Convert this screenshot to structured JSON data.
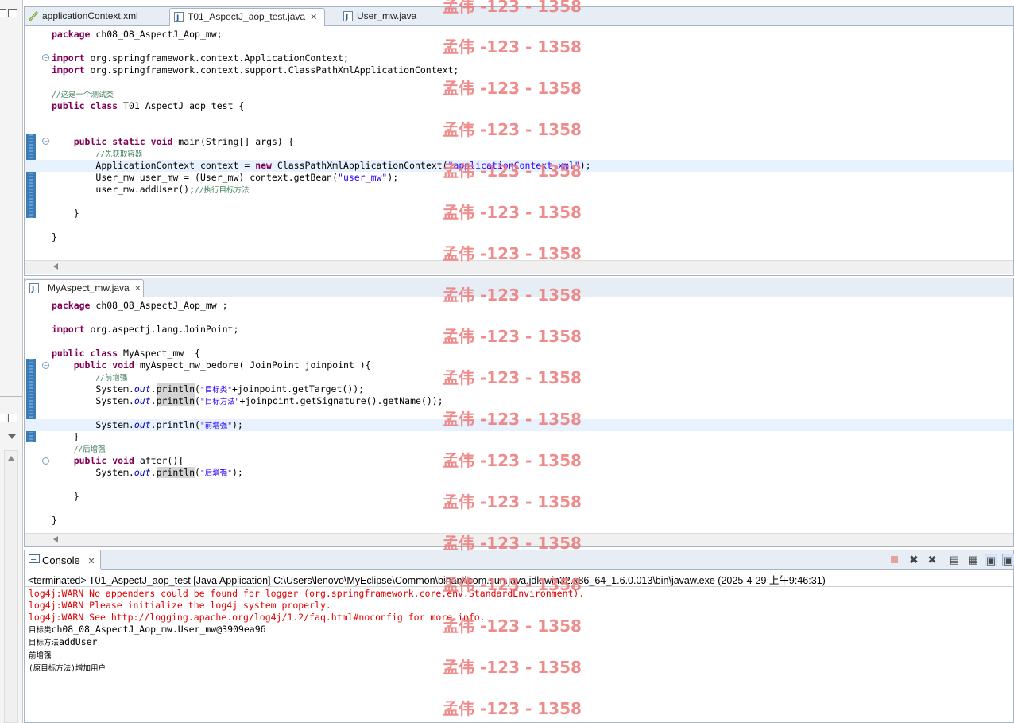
{
  "editor1": {
    "tabs": [
      {
        "label": "applicationContext.xml",
        "icon": "xml-file-icon"
      },
      {
        "label": "T01_AspectJ_aop_test.java",
        "icon": "java-file-icon",
        "active": true
      },
      {
        "label": "User_mw.java",
        "icon": "java-file-icon"
      }
    ],
    "close_glyph": "✕",
    "code": {
      "pkg_kw": "package",
      "pkg": " ch08_08_AspectJ_Aop_mw;",
      "imp_kw": "import",
      "imp1": " org.springframework.context.ApplicationContext;",
      "imp2": " org.springframework.context.support.ClassPathXmlApplicationContext;",
      "cm_class": "//这是一个测试类",
      "pub": "public",
      "cls": "class",
      "cls_decl": " T01_AspectJ_aop_test {",
      "stat": "static",
      "void": "void",
      "main_decl": " main(String[] args) {",
      "cm_get": "//先获取容器",
      "ctx_a": "ApplicationContext context = ",
      "new": "new",
      "ctx_b": " ClassPathXmlApplicationContext(",
      "ctx_str": "\"applicationContext.xml\"",
      "ctx_c": ");",
      "user_a": "User_mw user_mw = (User_mw) context.getBean(",
      "user_str": "\"user_mw\"",
      "user_c": ");",
      "add": "user_mw.addUser();",
      "cm_exec": "//执行目标方法",
      "close": "}"
    }
  },
  "editor2": {
    "tab": {
      "label": "MyAspect_mw.java",
      "icon": "java-file-icon"
    },
    "code": {
      "pkg_kw": "package",
      "pkg": " ch08_08_AspectJ_Aop_mw ;",
      "imp_kw": "import",
      "imp": " org.aspectj.lang.JoinPoint;",
      "pub": "public",
      "cls": "class",
      "cls_decl": " MyAspect_mw  {",
      "void": "void",
      "before_decl": " myAspect_mw_bedore( JoinPoint joinpoint ){",
      "cm_pre": "//前增强",
      "sys": "System.",
      "out": "out",
      "dot": ".",
      "println": "println",
      "s1": "\"目标类\"",
      "s1_rest": "+joinpoint.getTarget());",
      "s2": "\"目标方法\"",
      "s2_rest": "+joinpoint.getSignature().getName());",
      "s3": "\"前增强\"",
      "s4": "\"后增强\"",
      "lp": "(",
      "rp": ");",
      "cm_post": "//后增强",
      "after_decl": " after(){",
      "close": "}"
    }
  },
  "console": {
    "tab_label": "Console",
    "close_glyph": "✕",
    "terminated": "<terminated> T01_AspectJ_aop_test [Java Application] C:\\Users\\lenovo\\MyEclipse\\Common\\binary\\com.sun.java.jdk.win32.x86_64_1.6.0.013\\bin\\javaw.exe (2025-4-29 上午9:46:31)",
    "lines": [
      {
        "text": "log4j:WARN No appenders could be found for logger (org.springframework.core.env.StandardEnvironment).",
        "err": true
      },
      {
        "text": "log4j:WARN Please initialize the log4j system properly.",
        "err": true
      },
      {
        "text": "log4j:WARN See http://logging.apache.org/log4j/1.2/faq.html#noconfig for more info.",
        "err": true
      }
    ],
    "out1_cn": "目标类",
    "out1": "ch08_08_AspectJ_Aop_mw.User_mw@3909ea96",
    "out2_cn": "目标方法",
    "out2": "addUser",
    "out3_cn": "前增强",
    "out4_cn": "(原目标方法)增加用户",
    "toolbar": [
      "terminate-icon",
      "remove-launch-icon",
      "remove-all-terminated-icon",
      "scroll-lock-icon",
      "word-wrap-icon",
      "pin-console-icon",
      "display-console-icon"
    ]
  },
  "watermark": "孟伟 -123 - 1358",
  "colors": {
    "keyword": "#7f0055",
    "string": "#2a00ff",
    "comment": "#3f7f5f",
    "field": "#0000c0",
    "error": "#e00000",
    "watermark": "#eb7878"
  }
}
